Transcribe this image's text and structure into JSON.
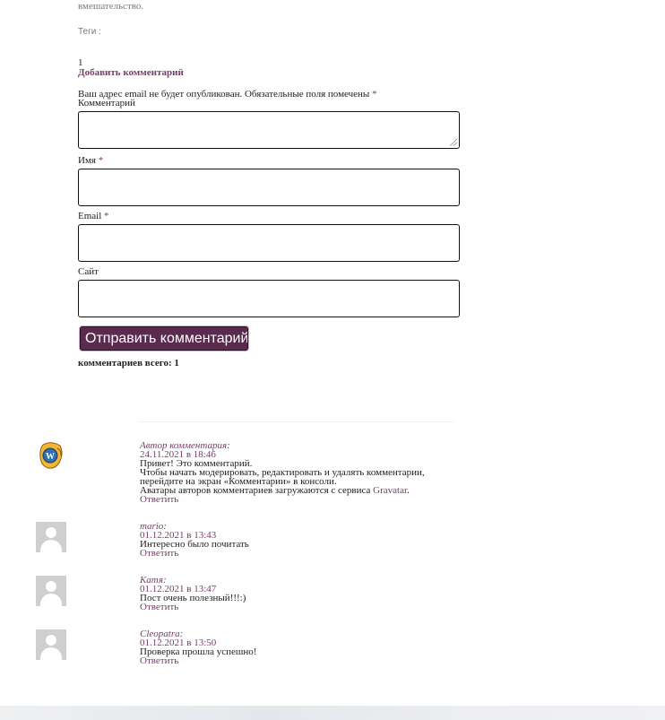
{
  "post": {
    "trailing_text": "вмешательство.",
    "tags_label": "Теги :",
    "comment_count_number": "1"
  },
  "comment_form": {
    "title": "Добавить комментарий",
    "notice": "Ваш адрес email не будет опубликован. Обязательные поля помечены",
    "required_mark": "*",
    "comment_label": "Комментарий",
    "name_label": "Имя",
    "email_label": "Email",
    "site_label": "Сайт",
    "submit_label": "Отправить комментарий",
    "total_label": "комментариев всего: 1"
  },
  "comments": [
    {
      "author": "Автор комментария",
      "date": "24.11.2021 в 18:46",
      "lines": [
        "Привет! Это комментарий.",
        "Чтобы начать модерировать, редактировать и удалять комментарии,",
        "перейдите на экран «Комментарии» в консоли.",
        "Аватары авторов комментариев загружаются с сервиса"
      ],
      "link_text": "Gravatar",
      "reply": "Ответить",
      "avatar": "wordpress-logo-avatar"
    },
    {
      "author": "mario",
      "date": "01.12.2021 в 13:43",
      "lines": [
        "Интересно было почитать"
      ],
      "reply": "Ответить",
      "avatar": "default-avatar"
    },
    {
      "author": "Катя",
      "date": "01.12.2021 в 13:47",
      "lines": [
        "Пост очень полезный!!!:)"
      ],
      "reply": "Ответить",
      "avatar": "default-avatar"
    },
    {
      "author": "Cleopatra",
      "date": "01.12.2021 в 13:50",
      "lines": [
        "Проверка прошла успешно!"
      ],
      "reply": "Ответить",
      "avatar": "default-avatar"
    }
  ],
  "colors": {
    "accent": "#7a3a6e",
    "button_bg": "#5b2b4f",
    "required": "#7a3a6e"
  }
}
